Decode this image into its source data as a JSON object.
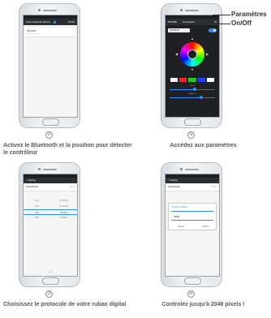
{
  "steps": [
    {
      "number": "①",
      "caption": "Activez le Bluetooth et la position pour détecter le contrôleur",
      "screen": {
        "appbar_title": "Scan bluetooth device",
        "appbar_right": "STOP",
        "device_name": "SP108E",
        "device_address": "xx:xx:xx:xx:xx:xx"
      }
    },
    {
      "number": "②",
      "caption": "Accédez aux paramètres",
      "screen": {
        "appbar_title": "SP108E",
        "appbar_status": "Connected",
        "mode_value": "RAINBOW",
        "speed_label": "Speed",
        "brightness_label": "Brightness",
        "colors": [
          "#ffffff",
          "#ff2222",
          "#22cc22",
          "#2244ff",
          "#ffffff"
        ],
        "speed": 0.55,
        "brightness": 0.7
      }
    },
    {
      "number": "③",
      "caption": "Choisissez le protocole de votre ruban digital",
      "screen": {
        "appbar_title": "< Setting",
        "row_label": "Total Pixels",
        "row_value": "60 >",
        "protocols": [
          [
            "TM1",
            "UCS1903"
          ],
          [
            "TM2",
            "UCS2903"
          ],
          [
            "1809",
            "WS2811"
          ],
          [
            "1903",
            "WS2801"
          ]
        ],
        "selected_index": 2,
        "footer": "DONE"
      }
    },
    {
      "number": "④",
      "caption": "Controlez jusqu'à 2048 pixels !",
      "screen": {
        "appbar_title": "< Setting",
        "row_label": "Total Pixels",
        "row_value": "60 >",
        "dialog_title": "TOTAL PIXELS",
        "dialog_value": "2048",
        "cancel": "Cancel",
        "confirm": "Confirm"
      }
    }
  ],
  "callout": {
    "params": "Paramètres",
    "onoff": "On/Off"
  }
}
